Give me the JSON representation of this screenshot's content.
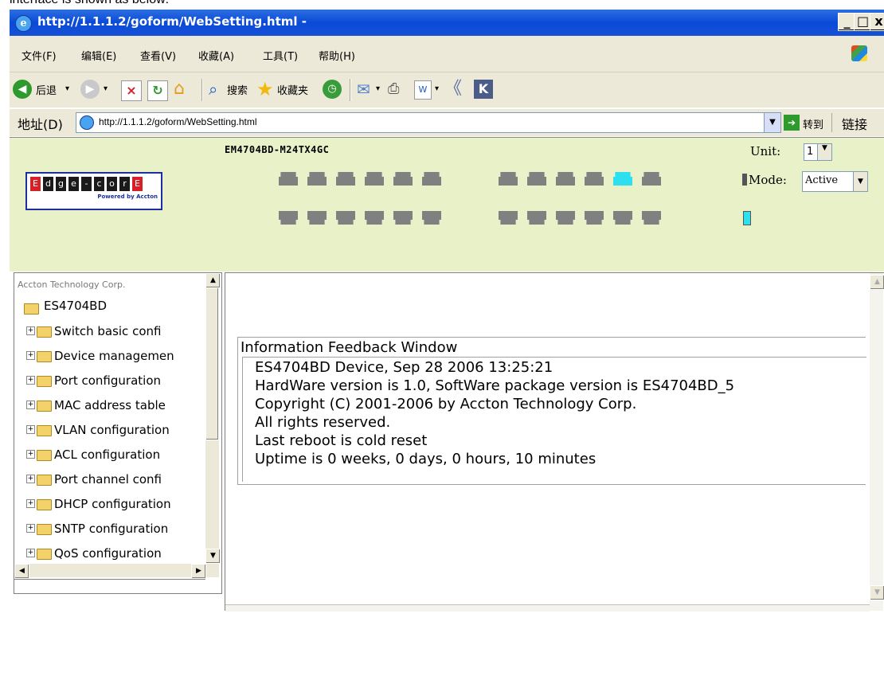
{
  "caption": "interface is shown as below:",
  "window": {
    "title": "http://1.1.1.2/goform/WebSetting.html -",
    "min": "_",
    "max": "□",
    "close": "x"
  },
  "menu": [
    "文件(F)",
    "编辑(E)",
    "查看(V)",
    "收藏(A)",
    "工具(T)",
    "帮助(H)"
  ],
  "toolbar": {
    "back": "后退",
    "search": "搜索",
    "favorites": "收藏夹"
  },
  "address": {
    "label": "地址(D)",
    "url": "http://1.1.1.2/goform/WebSetting.html",
    "go": "转到",
    "links": "链接"
  },
  "device": {
    "model": "EM4704BD-M24TX4GC",
    "logo_letters": [
      "E",
      "d",
      "g",
      "e",
      "-",
      "c",
      "o",
      "r",
      "E"
    ],
    "logo_sub": "Powered by Accton",
    "unit_label": "Unit:",
    "unit_value": "1",
    "mode_label": "Mode:",
    "mode_value": "Active",
    "active_port": 11
  },
  "sidebar": {
    "company": "Accton Technology Corp.",
    "root": "ES4704BD",
    "items": [
      "Switch basic confi",
      "Device managemen",
      "Port configuration",
      "MAC address table",
      "VLAN configuration",
      "ACL configuration",
      "Port channel confi",
      "DHCP configuration",
      "SNTP configuration",
      "QoS configuration"
    ]
  },
  "feedback": {
    "title": "Information Feedback Window",
    "lines": [
      "ES4704BD Device, Sep 28 2006 13:25:21",
      "HardWare version is 1.0, SoftWare package version is ES4704BD_5",
      "Copyright (C) 2001-2006 by Accton Technology Corp.",
      "All rights reserved.",
      "Last reboot is cold reset",
      "Uptime is 0 weeks, 0 days, 0 hours, 10 minutes"
    ]
  },
  "colors": {
    "titlebar": "#0a4ad8",
    "panel": "#e8f1c8",
    "port": "#808080",
    "port_active": "#2ee0ef"
  }
}
